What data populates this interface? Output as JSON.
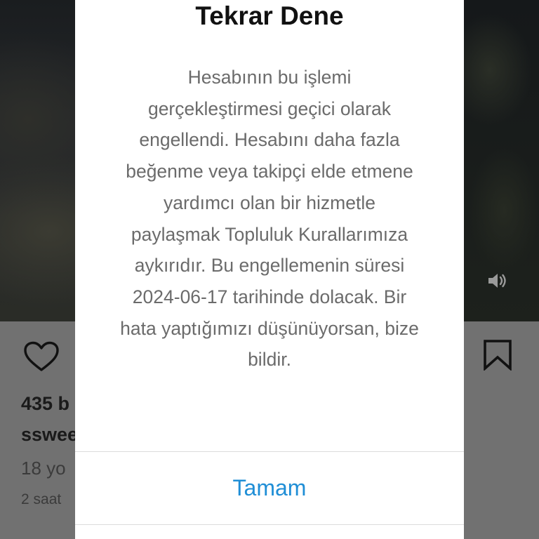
{
  "background_post": {
    "likes_text": "435 b",
    "caption_user": "sswee",
    "comments_text": "18 yo",
    "time_text": "2 saat",
    "icons": {
      "like": "heart-outline-icon",
      "bookmark": "bookmark-outline-icon",
      "volume": "volume-icon"
    }
  },
  "dialog": {
    "title": "Tekrar Dene",
    "message": "Hesabının bu işlemi gerçekleştirmesi geçici olarak engellendi. Hesabını daha fazla beğenme veya takipçi elde etmene yardımcı olan bir hizmetle paylaşmak Topluluk Kurallarımıza aykırıdır. Bu engellemenin süresi 2024-06-17 tarihinde dolacak. Bir hata yaptığımızı düşünüyorsan, bize bildir.",
    "ok_label": "Tamam"
  },
  "colors": {
    "ok_button": "#1f8ed6",
    "title": "#111111",
    "message": "#6b6b6b",
    "dialog_bg": "#ffffff",
    "overlay_footer": "#717171"
  }
}
